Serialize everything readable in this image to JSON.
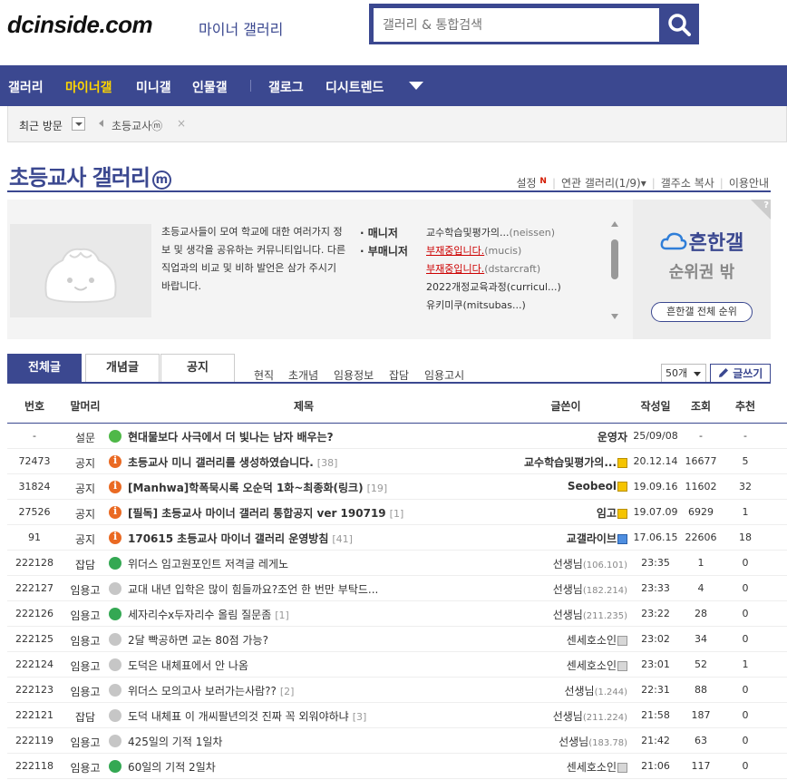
{
  "header": {
    "logo": "dcinside.com",
    "logo_sub": "마이너 갤러리",
    "search_placeholder": "갤러리 & 통합검색"
  },
  "nav": {
    "items": [
      "갤러리",
      "마이너갤",
      "미니갤",
      "인물갤",
      "갤로그",
      "디시트렌드"
    ],
    "active": "마이너갤"
  },
  "recent": {
    "label": "최근 방문",
    "items": [
      "초등교사",
      "ⓜ"
    ],
    "close": "×"
  },
  "gallery": {
    "title": "초등교사 갤러리",
    "badge": "m",
    "links": {
      "settings": "설정",
      "new_mark": "N",
      "related": "연관 갤러리(1/9)",
      "copy_url": "갤주소 복사",
      "guide": "이용안내"
    }
  },
  "info": {
    "description": "초등교사들이 모여 학교에 대한 여러가지 정보 및 생각을 공유하는 커뮤니티입니다. 다른 직업과의 비교 및 비하 발언은 삼가 주시기 바랍니다.",
    "manager_label": "· 매니저",
    "submanager_label": "· 부매니저",
    "managers": [
      {
        "name": "교수학습및평가의...",
        "id": "(neissen)"
      },
      {
        "name": "부재중입니다.",
        "id": "(mucis)"
      },
      {
        "name": "부재중입니다.",
        "id": "(dstarcraft)"
      },
      {
        "name": "2022개정교육과정",
        "id": "(curricul...)"
      },
      {
        "name": "유키미쿠",
        "id": "(mitsubas...)"
      }
    ],
    "rank": {
      "title": "흔한갤",
      "subtitle": "순위권 밖",
      "button": "흔한갤 전체 순위",
      "help": "?"
    }
  },
  "tabs": {
    "main": [
      "전체글",
      "개념글",
      "공지"
    ],
    "active": "전체글",
    "sub": [
      "현직",
      "초개념",
      "임용정보",
      "잡담",
      "임용고시"
    ],
    "count": "50개",
    "write": "글쓰기"
  },
  "table": {
    "columns": [
      "번호",
      "말머리",
      "제목",
      "글쓴이",
      "작성일",
      "조회",
      "추천"
    ],
    "rows": [
      {
        "num": "-",
        "head": "설문",
        "icon": "speaker",
        "subject": "현대물보다 사극에서 더 빛나는 남자 배우는?",
        "reply": "",
        "writer": "운영자",
        "ip": "",
        "badge": "",
        "date": "25/09/08",
        "views": "-",
        "rec": "-",
        "notice": true
      },
      {
        "num": "72473",
        "head": "공지",
        "icon": "notice",
        "subject": "초등교사 미니 갤러리를 생성하였습니다.",
        "reply": "[38]",
        "writer": "교수학습및평가의...",
        "ip": "",
        "badge": "gold",
        "date": "20.12.14",
        "views": "16677",
        "rec": "5",
        "notice": true
      },
      {
        "num": "31824",
        "head": "공지",
        "icon": "notice",
        "subject": "[Manhwa]학폭묵시록 오순덕 1화~최종화(링크)",
        "reply": "[19]",
        "writer": "Seobeol",
        "ip": "",
        "badge": "gold",
        "date": "19.09.16",
        "views": "11602",
        "rec": "32",
        "notice": true
      },
      {
        "num": "27526",
        "head": "공지",
        "icon": "notice",
        "subject": "[필독] 초등교사 마이너 갤러리 통합공지 ver 190719",
        "reply": "[1]",
        "writer": "임고",
        "ip": "",
        "badge": "gold",
        "date": "19.07.09",
        "views": "6929",
        "rec": "1",
        "notice": true
      },
      {
        "num": "91",
        "head": "공지",
        "icon": "notice",
        "subject": "170615 초등교사 마이너 갤러리 운영방침",
        "reply": "[41]",
        "writer": "교갤라이브",
        "ip": "",
        "badge": "blue",
        "date": "17.06.15",
        "views": "22606",
        "rec": "18",
        "notice": true
      },
      {
        "num": "222128",
        "head": "잡담",
        "icon": "image",
        "subject": "위더스 임고원포인트 저격글 레게노",
        "reply": "",
        "writer": "선생님",
        "ip": "(106.101)",
        "badge": "",
        "date": "23:35",
        "views": "1",
        "rec": "0",
        "notice": false
      },
      {
        "num": "222127",
        "head": "임용고",
        "icon": "talk",
        "subject": "교대 내년 입학은 많이 힘들까요?조언 한 번만 부탁드...",
        "reply": "",
        "writer": "선생님",
        "ip": "(182.214)",
        "badge": "",
        "date": "23:33",
        "views": "4",
        "rec": "0",
        "notice": false
      },
      {
        "num": "222126",
        "head": "임용고",
        "icon": "image",
        "subject": "세자리수x두자리수 올림 질문좀",
        "reply": "[1]",
        "writer": "선생님",
        "ip": "(211.235)",
        "badge": "",
        "date": "23:22",
        "views": "28",
        "rec": "0",
        "notice": false
      },
      {
        "num": "222125",
        "head": "임용고",
        "icon": "talk",
        "subject": "2달 빡공하면 교논 80점 가능?",
        "reply": "",
        "writer": "센세호소인",
        "ip": "",
        "badge": "gray",
        "date": "23:02",
        "views": "34",
        "rec": "0",
        "notice": false
      },
      {
        "num": "222124",
        "head": "임용고",
        "icon": "talk",
        "subject": "도덕은 내체표에서 안 나옴",
        "reply": "",
        "writer": "센세호소인",
        "ip": "",
        "badge": "gray",
        "date": "23:01",
        "views": "52",
        "rec": "1",
        "notice": false
      },
      {
        "num": "222123",
        "head": "임용고",
        "icon": "talk",
        "subject": "위더스 모의고사 보러가는사람??",
        "reply": "[2]",
        "writer": "선생님",
        "ip": "(1.244)",
        "badge": "",
        "date": "22:31",
        "views": "88",
        "rec": "0",
        "notice": false
      },
      {
        "num": "222121",
        "head": "잡담",
        "icon": "talk",
        "subject": "도덕 내체표 이 개씨팔년의것 진짜 꼭 외워야하냐",
        "reply": "[3]",
        "writer": "선생님",
        "ip": "(211.224)",
        "badge": "",
        "date": "21:58",
        "views": "187",
        "rec": "0",
        "notice": false
      },
      {
        "num": "222119",
        "head": "임용고",
        "icon": "talk",
        "subject": "425일의 기적 1일차",
        "reply": "",
        "writer": "선생님",
        "ip": "(183.78)",
        "badge": "",
        "date": "21:42",
        "views": "63",
        "rec": "0",
        "notice": false
      },
      {
        "num": "222118",
        "head": "임용고",
        "icon": "image",
        "subject": "60일의 기적 2일차",
        "reply": "",
        "writer": "센세호소인",
        "ip": "",
        "badge": "gray",
        "date": "21:06",
        "views": "117",
        "rec": "0",
        "notice": false
      }
    ]
  }
}
